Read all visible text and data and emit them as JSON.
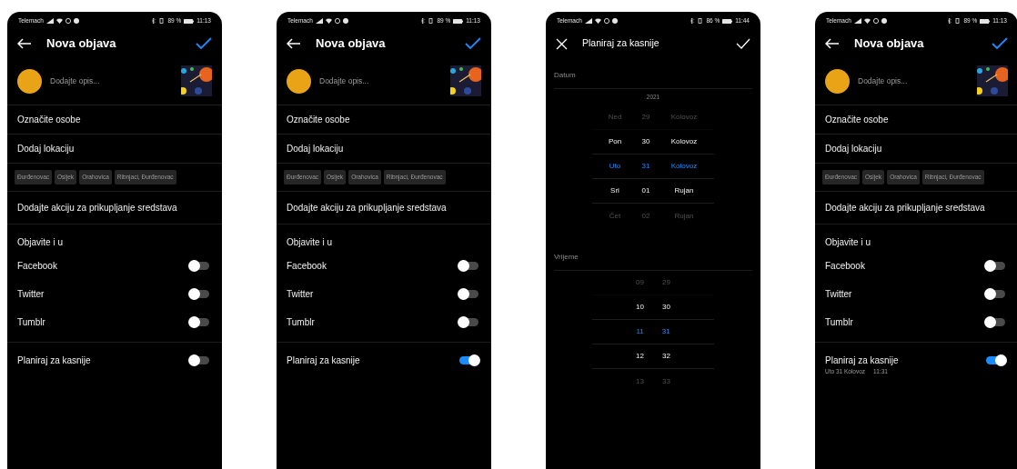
{
  "screens": [
    {
      "kind": "post",
      "status": {
        "carrier": "Telemach",
        "battery": "89 %",
        "time": "11:13"
      },
      "title": "Nova objava",
      "caption_placeholder": "Dodajte opis...",
      "tag_people": "Označite osobe",
      "add_location": "Dodaj lokaciju",
      "location_chips": [
        "Đurđenovac",
        "Osijek",
        "Orahovica",
        "Ribnjaci, Đurđenovac"
      ],
      "fundraiser": "Dodajte akciju za prikupljanje sredstava",
      "share_heading": "Objavite i u",
      "share_targets": [
        {
          "label": "Facebook",
          "on": false
        },
        {
          "label": "Twitter",
          "on": false
        },
        {
          "label": "Tumblr",
          "on": false
        }
      ],
      "schedule": {
        "label": "Planiraj za kasnije",
        "on": false
      }
    },
    {
      "kind": "post",
      "status": {
        "carrier": "Telemach",
        "battery": "89 %",
        "time": "11:13"
      },
      "title": "Nova objava",
      "caption_placeholder": "Dodajte opis...",
      "tag_people": "Označite osobe",
      "add_location": "Dodaj lokaciju",
      "location_chips": [
        "Đurđenovac",
        "Osijek",
        "Orahovica",
        "Ribnjaci, Đurđenovac"
      ],
      "fundraiser": "Dodajte akciju za prikupljanje sredstava",
      "share_heading": "Objavite i u",
      "share_targets": [
        {
          "label": "Facebook",
          "on": false
        },
        {
          "label": "Twitter",
          "on": false
        },
        {
          "label": "Tumblr",
          "on": false
        }
      ],
      "schedule": {
        "label": "Planiraj za kasnije",
        "on": true
      }
    },
    {
      "kind": "schedule",
      "status": {
        "carrier": "Telemach",
        "battery": "86 %",
        "time": "11:44"
      },
      "title": "Planiraj za kasnije",
      "date_label": "Datum",
      "year": "2021",
      "date_rows": [
        {
          "day": "Ned",
          "date": "29",
          "month": "Kolovoz",
          "selected": false,
          "dimmed": true
        },
        {
          "day": "Pon",
          "date": "30",
          "month": "Kolovoz",
          "selected": false,
          "dimmed": false
        },
        {
          "day": "Uto",
          "date": "31",
          "month": "Kolovoz",
          "selected": true,
          "dimmed": false
        },
        {
          "day": "Sri",
          "date": "01",
          "month": "Rujan",
          "selected": false,
          "dimmed": false
        },
        {
          "day": "Čet",
          "date": "02",
          "month": "Rujan",
          "selected": false,
          "dimmed": true
        }
      ],
      "time_label": "Vrijeme",
      "time_rows": [
        {
          "hour": "09",
          "minute": "29",
          "selected": false,
          "dimmed": true
        },
        {
          "hour": "10",
          "minute": "30",
          "selected": false,
          "dimmed": false
        },
        {
          "hour": "11",
          "minute": "31",
          "selected": true,
          "dimmed": false
        },
        {
          "hour": "12",
          "minute": "32",
          "selected": false,
          "dimmed": false
        },
        {
          "hour": "13",
          "minute": "33",
          "selected": false,
          "dimmed": true
        }
      ]
    },
    {
      "kind": "post",
      "status": {
        "carrier": "Telemach",
        "battery": "89 %",
        "time": "11:13"
      },
      "title": "Nova objava",
      "caption_placeholder": "Dodajte opis...",
      "tag_people": "Označite osobe",
      "add_location": "Dodaj lokaciju",
      "location_chips": [
        "Đurđenovac",
        "Osijek",
        "Orahovica",
        "Ribnjaci, Đurđenovac"
      ],
      "fundraiser": "Dodajte akciju za prikupljanje sredstava",
      "share_heading": "Objavite i u",
      "share_targets": [
        {
          "label": "Facebook",
          "on": false
        },
        {
          "label": "Twitter",
          "on": false
        },
        {
          "label": "Tumblr",
          "on": false
        }
      ],
      "schedule": {
        "label": "Planiraj za kasnije",
        "on": true,
        "date": "Uto 31 Kolovoz",
        "time": "11:31"
      }
    }
  ]
}
